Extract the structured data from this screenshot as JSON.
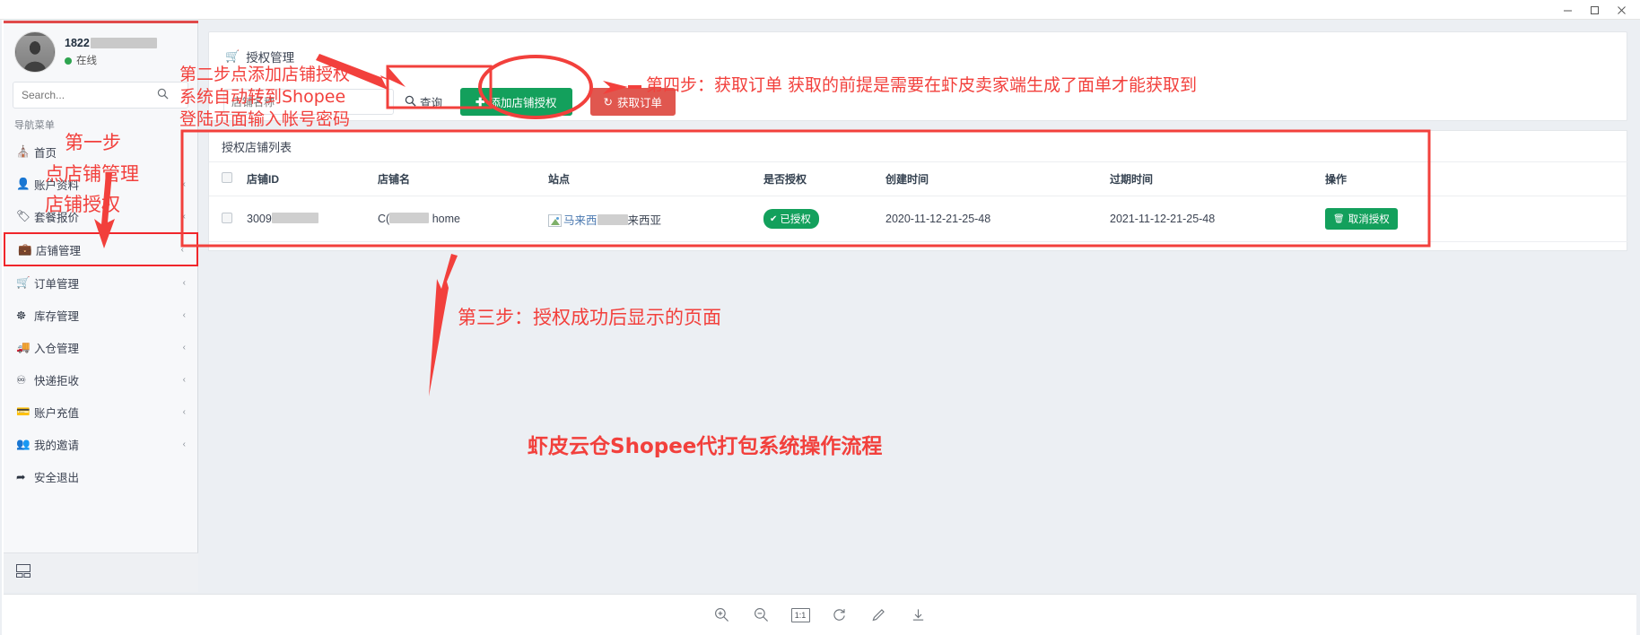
{
  "window": {
    "minimize": "minimize-icon",
    "maximize": "maximize-icon",
    "close": "close-icon"
  },
  "sidebar": {
    "profile": {
      "username": "1822",
      "status": "在线",
      "avatar": "user-avatar"
    },
    "search": {
      "placeholder": "Search...",
      "value": "",
      "icon": "search-icon"
    },
    "nav_title": "导航菜单",
    "items": [
      {
        "label": "首页",
        "icon": "home-icon",
        "caret": "",
        "highlight": false
      },
      {
        "label": "账户资料",
        "icon": "user-icon",
        "caret": "‹",
        "highlight": false
      },
      {
        "label": "套餐报价",
        "icon": "tag-icon",
        "caret": "‹",
        "highlight": false
      },
      {
        "label": "店铺管理",
        "icon": "briefcase-icon",
        "caret": "‹",
        "highlight": true
      },
      {
        "label": "订单管理",
        "icon": "cart-icon",
        "caret": "‹",
        "highlight": false
      },
      {
        "label": "库存管理",
        "icon": "boxes-icon",
        "caret": "‹",
        "highlight": false
      },
      {
        "label": "入仓管理",
        "icon": "truck-icon",
        "caret": "‹",
        "highlight": false
      },
      {
        "label": "快递拒收",
        "icon": "minus-circle-icon",
        "caret": "‹",
        "highlight": false
      },
      {
        "label": "账户充值",
        "icon": "credit-card-icon",
        "caret": "‹",
        "highlight": false
      },
      {
        "label": "我的邀请",
        "icon": "users-icon",
        "caret": "‹",
        "highlight": false
      },
      {
        "label": "安全退出",
        "icon": "logout-icon",
        "caret": "",
        "highlight": false
      }
    ],
    "footer_icon": "window-layout-icon"
  },
  "content": {
    "panel_title": "授权管理",
    "panel_title_icon": "cart-icon",
    "filter": {
      "placeholder": "店铺名称",
      "value": ""
    },
    "buttons": {
      "query": {
        "label": "查询",
        "icon": "search-icon"
      },
      "add_shop": {
        "label": "添加店铺授权",
        "icon": "plus-icon",
        "color": "#13a05c"
      },
      "fetch_orders": {
        "label": "获取订单",
        "icon": "refresh-icon",
        "color": "#e0574f"
      }
    },
    "table": {
      "caption": "授权店铺列表",
      "headers": [
        "",
        "店铺ID",
        "店铺名",
        "站点",
        "是否授权",
        "创建时间",
        "过期时间",
        "操作"
      ],
      "rows": [
        {
          "shop_id": "3009",
          "shop_name_prefix": "C(",
          "shop_name_suffix": "home",
          "site": "马来西",
          "site_suffix": "来西亚",
          "site_icon": "broken-image-icon",
          "authorized": "已授权",
          "authorized_icon": "check-circle-icon",
          "created": "2020-11-12-21-25-48",
          "expires": "2021-11-12-21-25-48",
          "action": "取消授权",
          "action_icon": "trash-icon"
        }
      ]
    }
  },
  "bottom_toolbar": {
    "zoom_in": "zoom-in-icon",
    "zoom_out": "zoom-out-icon",
    "actual_size": "1:1",
    "rotate": "rotate-icon",
    "edit": "pencil-icon",
    "download": "download-icon"
  },
  "annotations": {
    "color": "#f2403c",
    "step1_line1": "第一步",
    "step1_line2": "点店铺管理",
    "step1_line3": "店铺授权",
    "step2_line1": "第二步点添加店铺授权",
    "step2_line2": "系统自动转到Shopee",
    "step2_line3": "登陆页面输入帐号密码",
    "step3": "第三步：授权成功后显示的页面",
    "step4": "第四步：获取订单 获取的前提是需要在虾皮卖家端生成了面单才能获取到",
    "footer_title": "虾皮云仓Shopee代打包系统操作流程"
  }
}
